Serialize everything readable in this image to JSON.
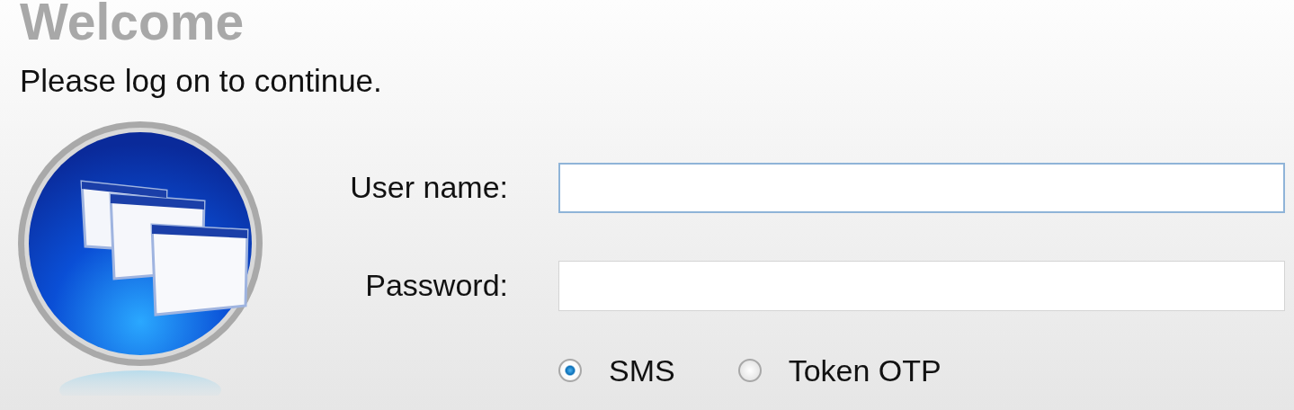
{
  "title": "Welcome",
  "subtitle": "Please log on to continue.",
  "fields": [
    {
      "label": "User name:",
      "focused": true
    },
    {
      "label": "Password:",
      "focused": false
    }
  ],
  "auth_methods": [
    {
      "label": "SMS",
      "selected": true
    },
    {
      "label": "Token OTP",
      "selected": false
    }
  ]
}
